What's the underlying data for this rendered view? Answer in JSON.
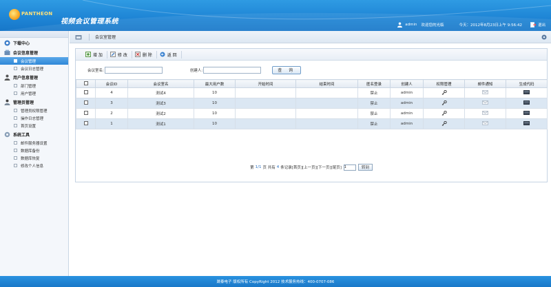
{
  "header": {
    "brand": "PANTHEON",
    "system_title": "视频会议管理系统",
    "user": "admin",
    "welcome": "欢迎您的光临",
    "date": "今天：2012年8月23日上午  9:56:42",
    "logout": "退出"
  },
  "sidebar": {
    "sections": [
      {
        "label": "下载中心",
        "icon": "download-icon",
        "items": []
      },
      {
        "label": "会议信息管理",
        "icon": "meeting-icon",
        "items": [
          {
            "label": "会议管理",
            "active": true
          },
          {
            "label": "会议日志管理",
            "active": false
          }
        ]
      },
      {
        "label": "用户信息管理",
        "icon": "users-icon",
        "items": [
          {
            "label": "部门管理",
            "active": false
          },
          {
            "label": "用户管理",
            "active": false
          }
        ]
      },
      {
        "label": "管理员管理",
        "icon": "admin-icon",
        "items": [
          {
            "label": "管理员权限管理",
            "active": false
          },
          {
            "label": "操作日志管理",
            "active": false
          },
          {
            "label": "首页设置",
            "active": false
          }
        ]
      },
      {
        "label": "系统工具",
        "icon": "tools-icon",
        "items": [
          {
            "label": "邮件服务器设置",
            "active": false
          },
          {
            "label": "数据库备份",
            "active": false
          },
          {
            "label": "数据库恢复",
            "active": false
          },
          {
            "label": "修改个人信息",
            "active": false
          }
        ]
      }
    ]
  },
  "breadcrumb": "会议室管理",
  "toolbar": {
    "add": "增 加",
    "edit": "修 改",
    "delete": "删 除",
    "back": "返 回"
  },
  "search": {
    "room_label": "会议室名:",
    "room_value": "",
    "creator_label": "创建人:",
    "creator_value": "",
    "button": "查 询"
  },
  "table": {
    "columns": [
      "会议ID",
      "会议室名",
      "最大用户数",
      "开始时间",
      "结束时间",
      "匿名登录",
      "创建人",
      "权限管理",
      "邮件通知",
      "生成代码"
    ],
    "rows": [
      {
        "id": "4",
        "name": "测试4",
        "max_users": "10",
        "start": "",
        "end": "",
        "anonymous": "禁止",
        "creator": "admin"
      },
      {
        "id": "3",
        "name": "测试3",
        "max_users": "10",
        "start": "",
        "end": "",
        "anonymous": "禁止",
        "creator": "admin"
      },
      {
        "id": "2",
        "name": "测试2",
        "max_users": "10",
        "start": "",
        "end": "",
        "anonymous": "禁止",
        "creator": "admin"
      },
      {
        "id": "1",
        "name": "测试1",
        "max_users": "10",
        "start": "",
        "end": "",
        "anonymous": "禁止",
        "creator": "admin"
      }
    ]
  },
  "pager": {
    "prefix": "第",
    "page": "1/1",
    "mid": "页  共有",
    "count": "4",
    "suffix": "条记录",
    "first": "[首页]",
    "prev": "[上一页]",
    "next": "[下一页]",
    "last": "[尾页]",
    "input_value": "1",
    "go": "转到"
  },
  "footer": "晟泰电子 版权所有 CopyRight 2012 技术服务热线：400-0707-086",
  "colors": {
    "header_blue": "#1f86d6",
    "active_item": "#2f88d8",
    "row_alt": "#dbe7f3"
  }
}
